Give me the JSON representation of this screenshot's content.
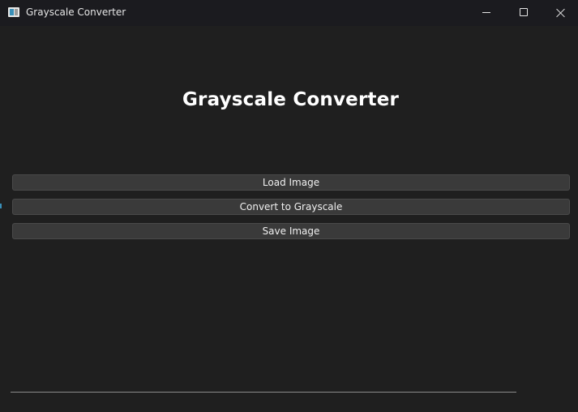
{
  "window": {
    "title": "Grayscale Converter",
    "accent_color": "#3a8fb7",
    "caption_buttons": [
      "minimize-icon",
      "maximize-icon",
      "close-icon"
    ]
  },
  "main": {
    "heading": "Grayscale Converter",
    "buttons": {
      "load": "Load Image",
      "convert": "Convert to Grayscale",
      "save": "Save Image"
    }
  },
  "status": {
    "progress_percent": 0
  }
}
